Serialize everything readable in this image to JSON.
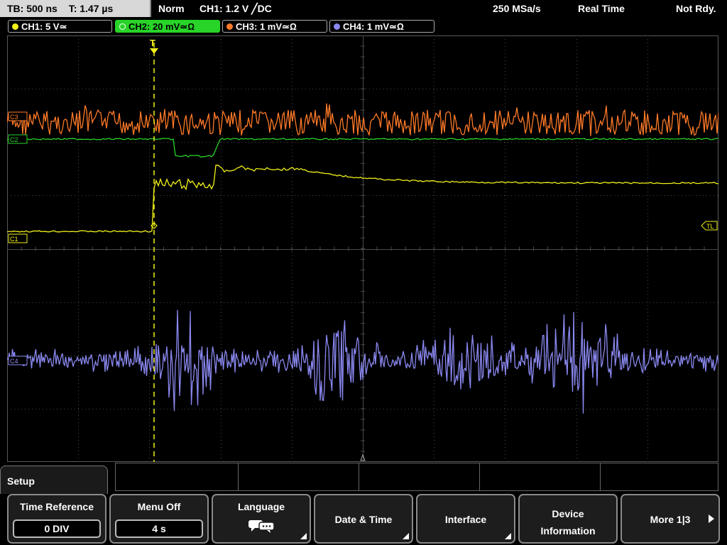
{
  "status": {
    "tb": "TB: 500 ns",
    "t": "T: 1.47 µs",
    "mode": "Norm",
    "trigger": "CH1: 1.2 V ╱DC",
    "sample_rate": "250 MSa/s",
    "acq": "Real Time",
    "state": "Not Rdy."
  },
  "channels": [
    {
      "label": "CH1: 5 V≃",
      "color": "#f2f21a",
      "active": false
    },
    {
      "label": "CH2: 20 mV≃Ω",
      "color": "#28d428",
      "active": true
    },
    {
      "label": "CH3: 1 mV≃Ω",
      "color": "#ff7a28",
      "active": false
    },
    {
      "label": "CH4: 1 mV≃Ω",
      "color": "#8a88f0",
      "active": false
    }
  ],
  "markers": {
    "c1": "C1",
    "c2": "C2",
    "c3": "C3",
    "c4": "C4",
    "trigger_level": "TL",
    "trigger_pos": "T"
  },
  "menu": {
    "title": "Setup",
    "keys": [
      {
        "label": "Time Reference",
        "value": "0 DIV"
      },
      {
        "label": "Menu Off",
        "value": "4 s"
      },
      {
        "label": "Language"
      },
      {
        "label": "Date & Time"
      },
      {
        "label": "Interface"
      },
      {
        "label_line1": "Device",
        "label_line2": "Information"
      },
      {
        "label": "More 1|3"
      }
    ]
  },
  "colors": {
    "grid": "#4a4a4a",
    "ch1": "#f2f21a",
    "ch2": "#28d428",
    "ch3": "#ff7a28",
    "ch4": "#8a88f0"
  }
}
